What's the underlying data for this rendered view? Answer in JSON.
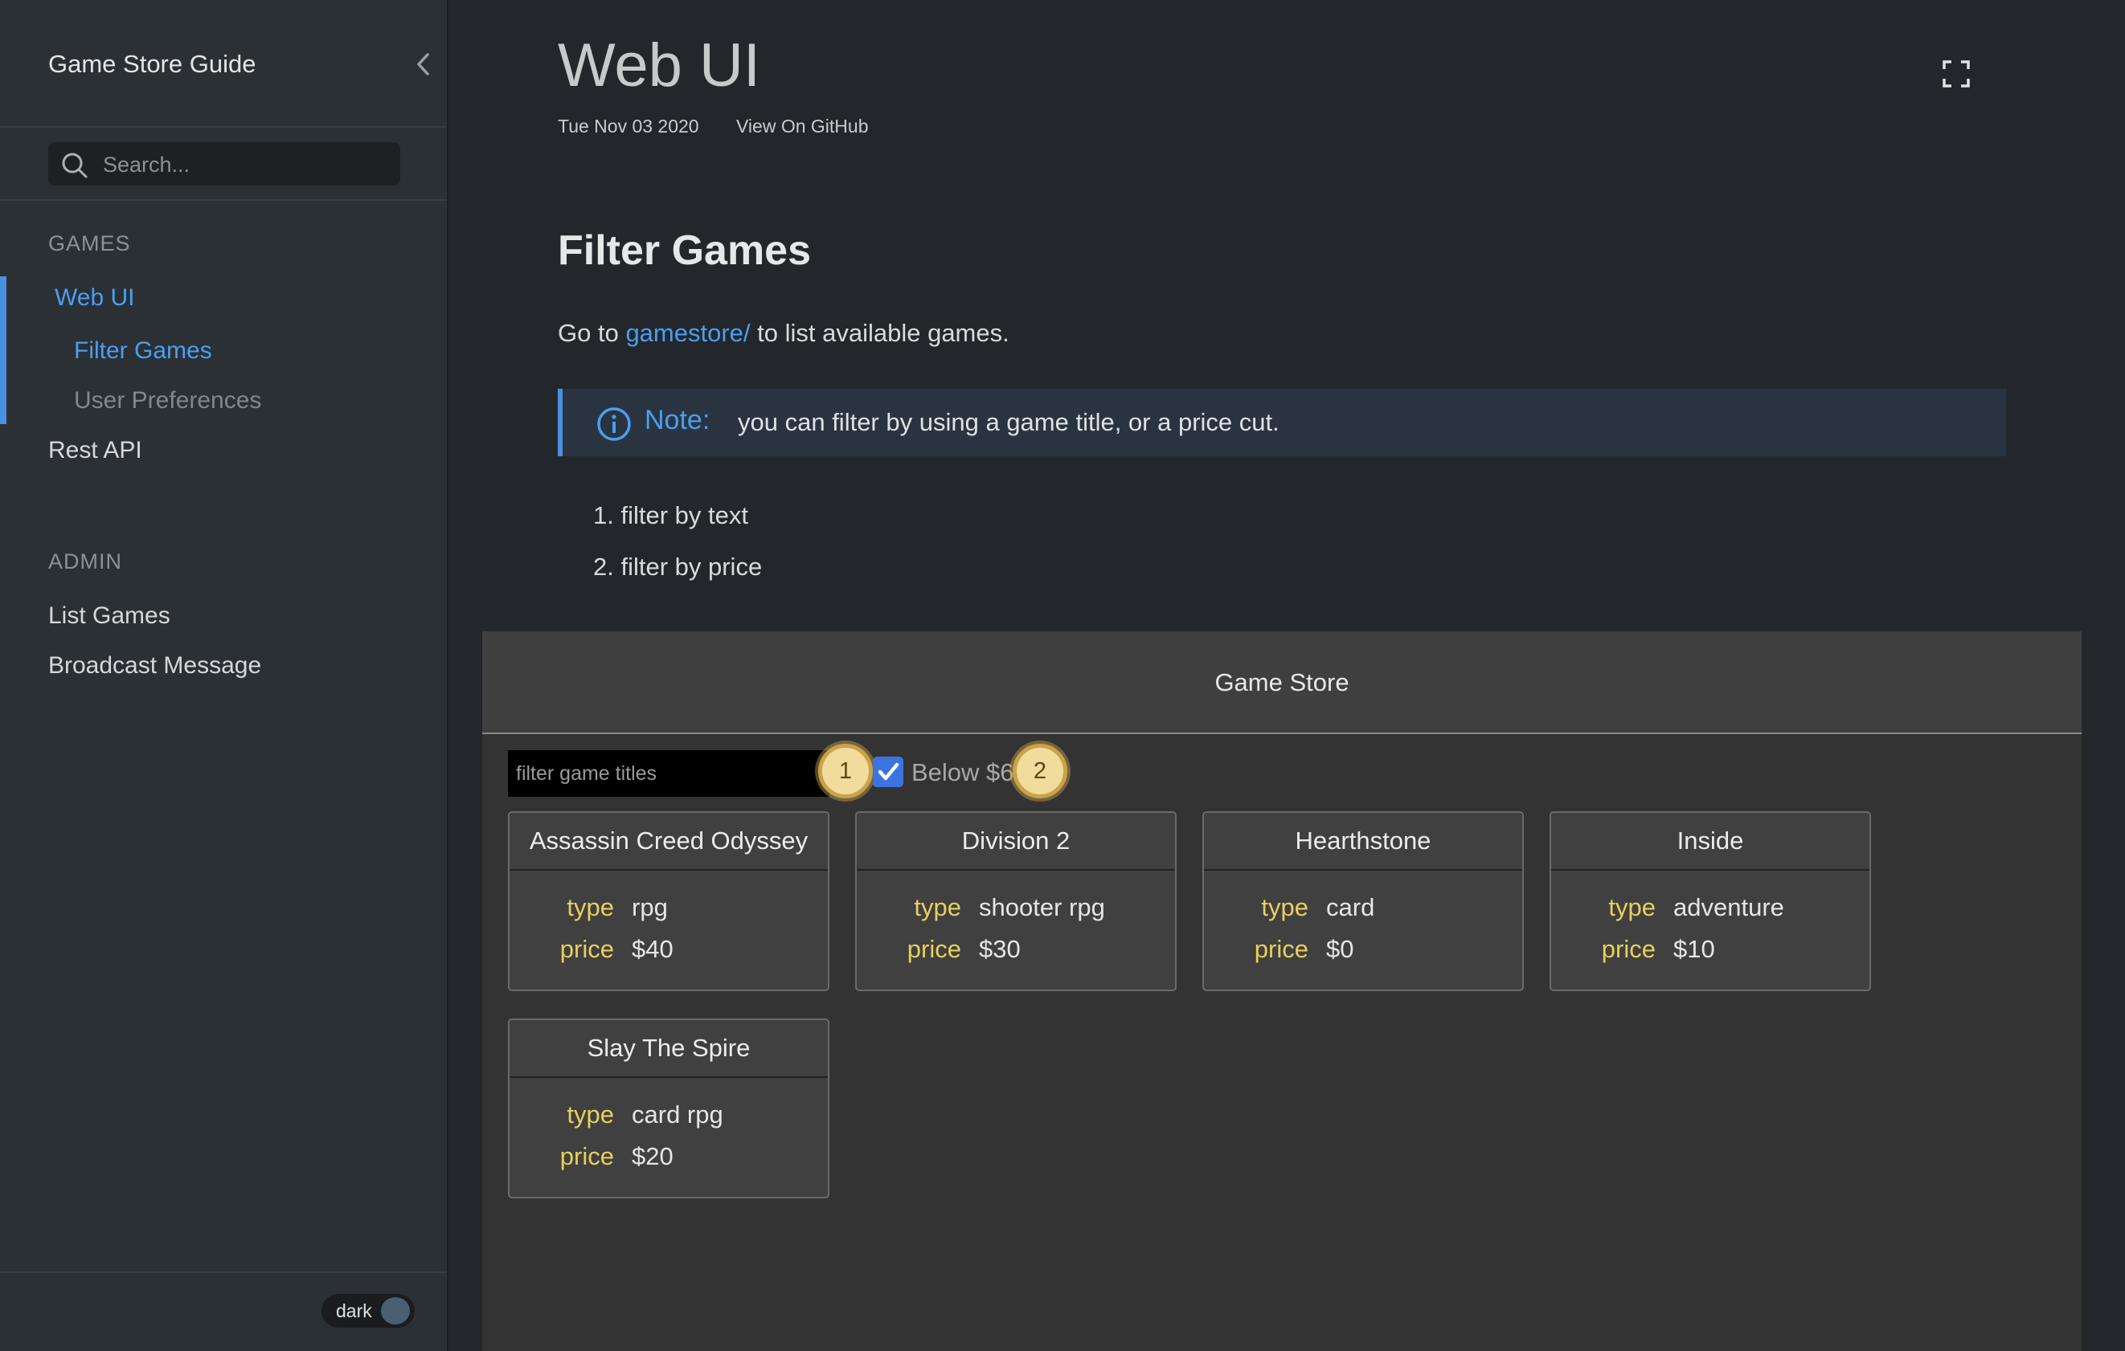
{
  "sidebar": {
    "title": "Game Store Guide",
    "search_placeholder": "Search...",
    "sections": [
      {
        "label": "GAMES"
      },
      {
        "label": "ADMIN"
      }
    ],
    "items": {
      "web_ui": "Web UI",
      "filter_games": "Filter Games",
      "user_preferences": "User Preferences",
      "rest_api": "Rest API",
      "list_games": "List Games",
      "broadcast_message": "Broadcast Message"
    },
    "theme_toggle": "dark"
  },
  "page": {
    "title": "Web UI",
    "date": "Tue Nov 03 2020",
    "github_link": "View On GitHub",
    "section_heading": "Filter Games",
    "para_prefix": "Go to ",
    "para_link": "gamestore/",
    "para_suffix": " to list available games.",
    "note_label": "Note:",
    "note_text": "you can filter by using a game title, or a price cut.",
    "list": [
      "1. filter by text",
      "2. filter by price"
    ]
  },
  "app": {
    "title": "Game Store",
    "filter_placeholder": "filter game titles",
    "below_label": "Below $6",
    "below_checked": true,
    "badges": [
      "1",
      "2"
    ],
    "type_key": "type",
    "price_key": "price",
    "games": [
      {
        "title": "Assassin Creed Odyssey",
        "type": "rpg",
        "price": "$40"
      },
      {
        "title": "Division 2",
        "type": "shooter rpg",
        "price": "$30"
      },
      {
        "title": "Hearthstone",
        "type": "card",
        "price": "$0"
      },
      {
        "title": "Inside",
        "type": "adventure",
        "price": "$10"
      },
      {
        "title": "Slay The Spire",
        "type": "card rpg",
        "price": "$20"
      }
    ]
  },
  "colors": {
    "accent": "#4c9ef0",
    "key_yellow": "#e8cf5e",
    "badge": "#f2dc9d"
  }
}
